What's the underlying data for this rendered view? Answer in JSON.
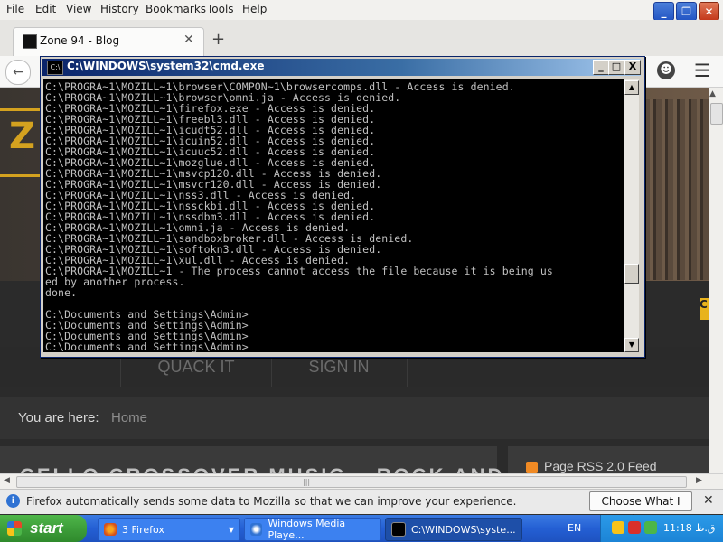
{
  "firefox": {
    "menu": [
      "File",
      "Edit",
      "View",
      "History",
      "Bookmarks",
      "Tools",
      "Help"
    ],
    "tab_title": "Zone 94 - Blog",
    "tab_close": "✕",
    "new_tab": "+",
    "back_icon": "←",
    "hamburger": "☰",
    "smiley": "☻"
  },
  "page": {
    "logo_letter": "Z",
    "side_badge": "C",
    "nav": [
      "QUACK IT",
      "SIGN IN"
    ],
    "breadcrumb_label": "You are here:",
    "breadcrumb_home": "Home",
    "article_title": "CELLO CROSSOVER MUSIC – ROCK AND",
    "rss_text": "Page RSS 2.0 Feed"
  },
  "notification": {
    "icon": "i",
    "text": "Firefox automatically sends some data to Mozilla so that we can improve your experience.",
    "button": "Choose What I Share",
    "close": "✕"
  },
  "cmd": {
    "title": "C:\\WINDOWS\\system32\\cmd.exe",
    "icon_text": "C:\\",
    "buttons": [
      "_",
      "□",
      "X"
    ],
    "lines": [
      "C:\\PROGRA~1\\MOZILL~1\\browser\\COMPON~1\\browsercomps.dll - Access is denied.",
      "C:\\PROGRA~1\\MOZILL~1\\browser\\omni.ja - Access is denied.",
      "C:\\PROGRA~1\\MOZILL~1\\firefox.exe - Access is denied.",
      "C:\\PROGRA~1\\MOZILL~1\\freebl3.dll - Access is denied.",
      "C:\\PROGRA~1\\MOZILL~1\\icudt52.dll - Access is denied.",
      "C:\\PROGRA~1\\MOZILL~1\\icuin52.dll - Access is denied.",
      "C:\\PROGRA~1\\MOZILL~1\\icuuc52.dll - Access is denied.",
      "C:\\PROGRA~1\\MOZILL~1\\mozglue.dll - Access is denied.",
      "C:\\PROGRA~1\\MOZILL~1\\msvcp120.dll - Access is denied.",
      "C:\\PROGRA~1\\MOZILL~1\\msvcr120.dll - Access is denied.",
      "C:\\PROGRA~1\\MOZILL~1\\nss3.dll - Access is denied.",
      "C:\\PROGRA~1\\MOZILL~1\\nssckbi.dll - Access is denied.",
      "C:\\PROGRA~1\\MOZILL~1\\nssdbm3.dll - Access is denied.",
      "C:\\PROGRA~1\\MOZILL~1\\omni.ja - Access is denied.",
      "C:\\PROGRA~1\\MOZILL~1\\sandboxbroker.dll - Access is denied.",
      "C:\\PROGRA~1\\MOZILL~1\\softokn3.dll - Access is denied.",
      "C:\\PROGRA~1\\MOZILL~1\\xul.dll - Access is denied.",
      "C:\\PROGRA~1\\MOZILL~1 - The process cannot access the file because it is being us",
      "ed by another process.",
      "done.",
      "",
      "C:\\Documents and Settings\\Admin>",
      "C:\\Documents and Settings\\Admin>",
      "C:\\Documents and Settings\\Admin>",
      "C:\\Documents and Settings\\Admin>"
    ]
  },
  "taskbar": {
    "start": "start",
    "items": [
      "3 Firefox",
      "Windows Media Playe...",
      "C:\\WINDOWS\\syste..."
    ],
    "language": "EN",
    "clock": "11:18 ق.ظ"
  }
}
